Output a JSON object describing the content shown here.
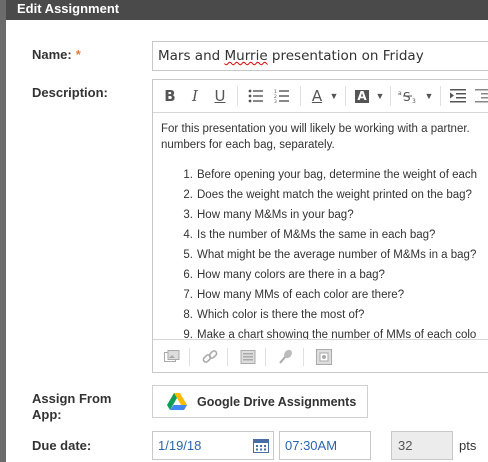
{
  "dialog": {
    "title": "Edit Assignment"
  },
  "name": {
    "label": "Name:",
    "required_marker": "*",
    "value_prefix": "Mars and ",
    "value_misspelled": "Murrie",
    "value_suffix": " presentation on Friday"
  },
  "description": {
    "label": "Description:",
    "intro_line1": "For this presentation you will likely be working with a partner.",
    "intro_line2": "numbers for each bag, separately.",
    "steps": [
      {
        "num": "1.",
        "text": "Before opening your bag, determine the weight of each"
      },
      {
        "num": "2.",
        "text": "Does the weight match the weight printed on the bag?"
      },
      {
        "num": "3.",
        "text": "How many M&Ms in your bag?"
      },
      {
        "num": "4.",
        "text": "Is the number of M&Ms the same in each bag?"
      },
      {
        "num": "5.",
        "text": "What might be the average number of M&Ms in a bag?"
      },
      {
        "num": "6.",
        "text": "How many colors are there in a bag?"
      },
      {
        "num": "7.",
        "text": "How many MMs of each color are there?"
      },
      {
        "num": "8.",
        "text": "Which color is there the most of?"
      },
      {
        "num": "9.",
        "text": "Make a chart showing the number of MMs of each colo"
      }
    ],
    "toolbar": {
      "bold": "B",
      "italic": "I",
      "underline": "U",
      "font_color": "A",
      "bg_color": "A"
    }
  },
  "assign_from_app": {
    "label_line1": "Assign From",
    "label_line2": "App:",
    "button_label": "Google Drive Assignments"
  },
  "due_date": {
    "label": "Due date:",
    "date": "1/19/18",
    "time": "07:30AM",
    "points": "32",
    "points_unit": "pts"
  },
  "colors": {
    "titlebar": "#4a4a4a",
    "required": "#e07b39",
    "input_text": "#2a66b0"
  }
}
